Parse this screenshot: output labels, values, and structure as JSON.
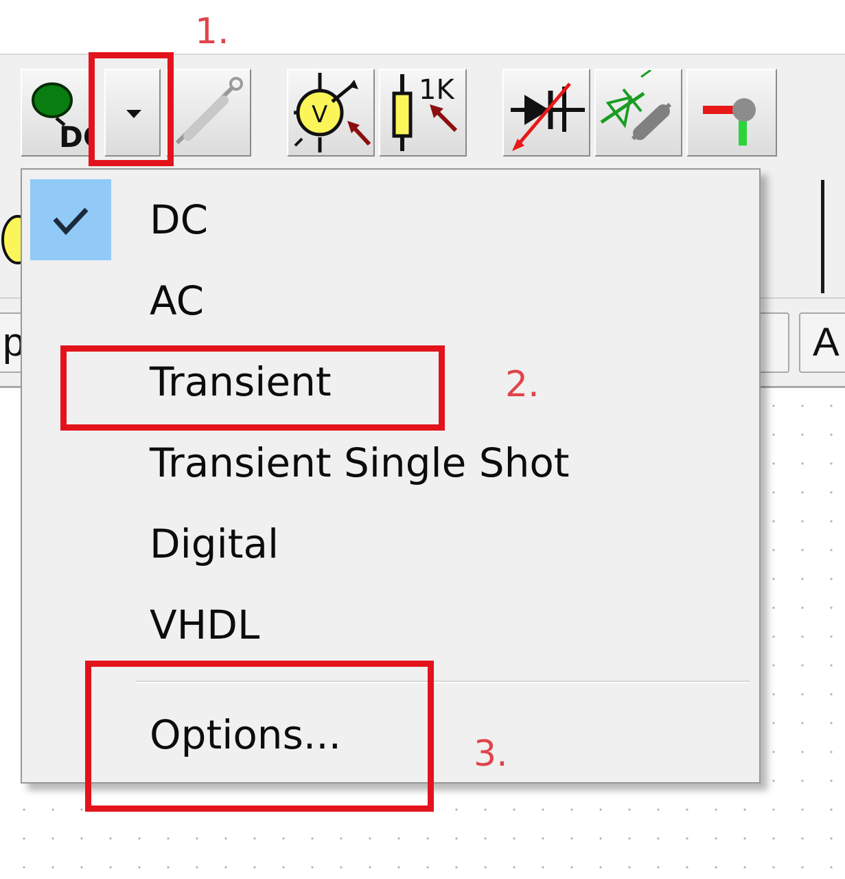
{
  "toolbar": {
    "dc_button": {
      "icon": "dc-analysis-icon",
      "label": "DC"
    },
    "mode_dropdown": {
      "icon": "chevron-down-icon"
    },
    "probe_button": {
      "icon": "probe-icon"
    },
    "voltmeter_button": {
      "icon": "voltmeter-icon",
      "label": "V"
    },
    "resistor_button": {
      "icon": "resistor-1k-icon",
      "label": "1K"
    },
    "diode_button": {
      "icon": "diode-icon"
    },
    "led_button": {
      "icon": "led-icon"
    },
    "wire_button": {
      "icon": "wire-node-icon"
    }
  },
  "tab_row": {
    "tab_left_fragment": "p",
    "tab_right_fragment": "A"
  },
  "menu": {
    "items": [
      {
        "label": "DC",
        "checked": true
      },
      {
        "label": "AC"
      },
      {
        "label": "Transient"
      },
      {
        "label": "Transient Single Shot"
      },
      {
        "label": "Digital"
      },
      {
        "label": "VHDL"
      },
      {
        "label": "Options..."
      }
    ]
  },
  "annotations": {
    "step1": "1.",
    "step2": "2.",
    "step3": "3.",
    "highlight_color": "#e3131c",
    "step_color": "#e0444a"
  },
  "colors": {
    "menu_background": "#f0f0f0",
    "check_highlight": "#91c9f7"
  }
}
